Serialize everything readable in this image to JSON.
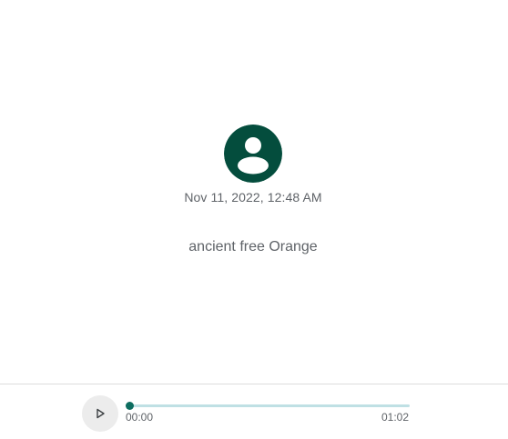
{
  "message": {
    "avatar_icon": "person-circle-icon",
    "avatar_color": "#044d3d",
    "timestamp": "Nov 11, 2022, 12:48 AM",
    "text": "ancient free Orange"
  },
  "player": {
    "play_icon": "play-icon",
    "current_time": "00:00",
    "total_time": "01:02",
    "progress_fraction": 0.0,
    "accent_color": "#0d6d60",
    "track_color": "#bfe0e4"
  }
}
